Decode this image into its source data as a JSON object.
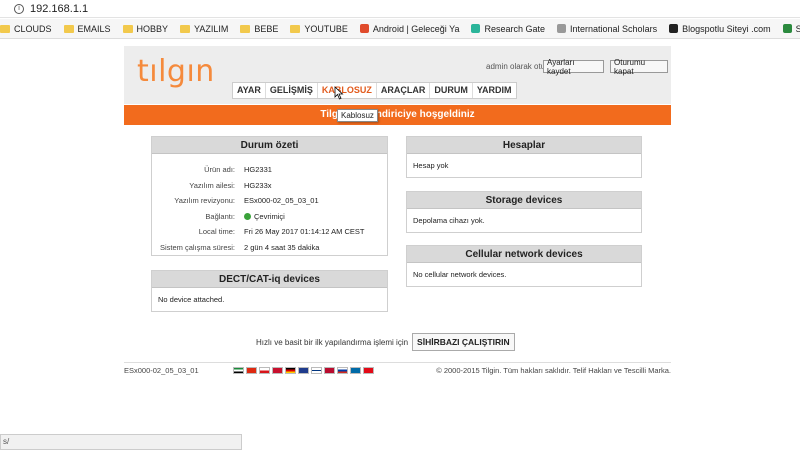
{
  "browser": {
    "url": "192.168.1.1",
    "bookmarks": [
      {
        "label": "CLOUDS",
        "kind": "folder"
      },
      {
        "label": "EMAILS",
        "kind": "folder"
      },
      {
        "label": "HOBBY",
        "kind": "folder"
      },
      {
        "label": "YAZILIM",
        "kind": "folder"
      },
      {
        "label": "BEBE",
        "kind": "folder"
      },
      {
        "label": "YOUTUBE",
        "kind": "folder"
      },
      {
        "label": "Android | Geleceği Ya",
        "kind": "site",
        "color": "#e04b2c"
      },
      {
        "label": "Research Gate",
        "kind": "site",
        "color": "#2bb59a"
      },
      {
        "label": "International Scholars",
        "kind": "site",
        "color": "#999999"
      },
      {
        "label": "Blogspotlu Siteyi .com",
        "kind": "site",
        "color": "#222222"
      },
      {
        "label": "StartApp User Dashbo",
        "kind": "site",
        "color": "#2b8a3e"
      }
    ],
    "statusbar": "s/"
  },
  "header": {
    "logo": "tılgın",
    "admin_text": "admin olarak oturum açtınız.",
    "save_button": "Ayarları kaydet",
    "logout_button": "Oturumu kapat"
  },
  "nav": {
    "items": [
      "AYAR",
      "GELİŞMİŞ",
      "KABLOSUZ",
      "ARAÇLAR",
      "DURUM",
      "YARDIM"
    ],
    "active_index": 2
  },
  "tooltip": "Kablosuz",
  "banner": "Tilgin yönlendiriciye hoşgeldiniz",
  "status": {
    "title": "Durum özeti",
    "rows": [
      {
        "k": "Ürün adı:",
        "v": "HG2331"
      },
      {
        "k": "Yazılım ailesi:",
        "v": "HG233x"
      },
      {
        "k": "Yazılım revizyonu:",
        "v": "ESx000-02_05_03_01"
      },
      {
        "k": "Bağlantı:",
        "v": "Çevrimiçi"
      },
      {
        "k": "Local time:",
        "v": "Fri 26 May 2017 01:14:12 AM CEST"
      },
      {
        "k": "Sistem çalışma süresi:",
        "v": "2 gün 4 saat 35 dakika"
      }
    ]
  },
  "dect": {
    "title": "DECT/CAT-iq devices",
    "body": "No device attached."
  },
  "accounts": {
    "title": "Hesaplar",
    "body": "Hesap yok"
  },
  "storage": {
    "title": "Storage devices",
    "body": "Depolama cihazı yok."
  },
  "cellular": {
    "title": "Cellular network devices",
    "body": "No cellular network devices."
  },
  "wizard": {
    "text": "Hızlı ve basit bir ilk yapılandırma işlemi için",
    "button": "SİHİRBAZI ÇALIŞTIRIN"
  },
  "footer": {
    "version": "ESx000-02_05_03_01",
    "copyright": "© 2000-2015 Tilgin. Tüm hakları saklıdır. Telif Hakları ve Tescilli Marka."
  },
  "colors": {
    "accent": "#f26b1d",
    "logo": "#f58a3c"
  }
}
